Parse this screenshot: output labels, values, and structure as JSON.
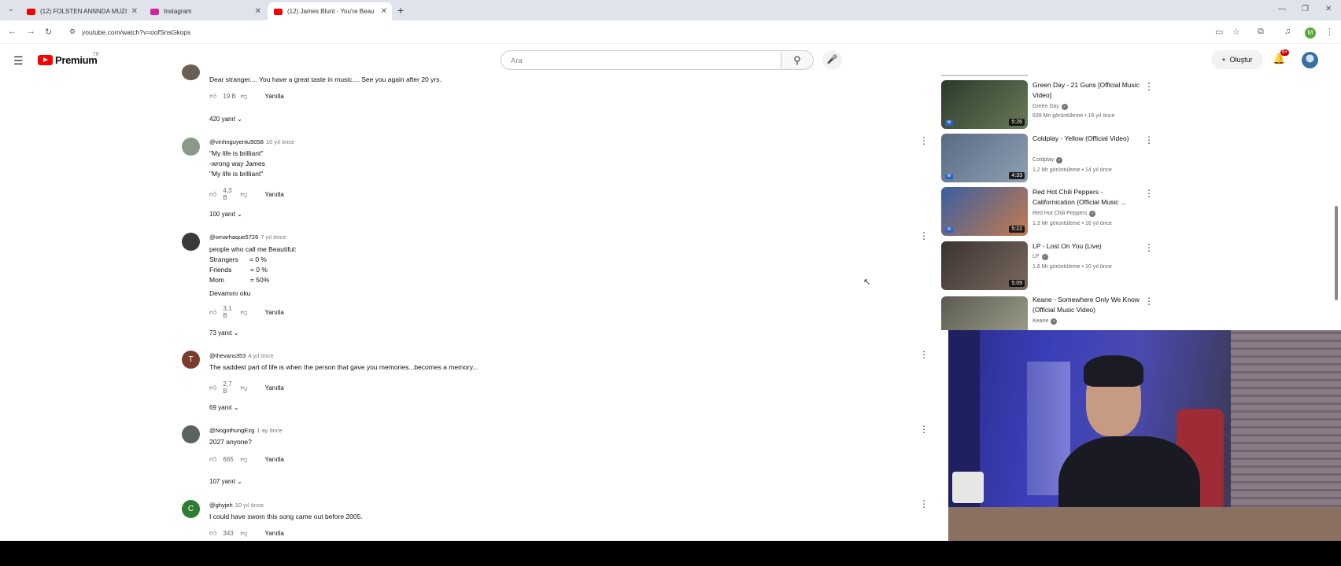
{
  "browser": {
    "tabs": [
      {
        "label": "(12) FOLSTEN ANNNDA MUZI...",
        "active": false,
        "color": "#ff0000"
      },
      {
        "label": "Instagram",
        "active": false,
        "color": "#d6249f"
      },
      {
        "label": "(12) James Blunt - You're Beau...",
        "active": true,
        "color": "#ff0000"
      }
    ],
    "url": "youtube.com/watch?v=oofSnsGkops",
    "profile_initial": "M"
  },
  "youtube": {
    "logo_text": "Premium",
    "logo_sup": "TR",
    "search_placeholder": "Ara",
    "create_label": "Oluştur",
    "notif_count": "9+"
  },
  "comments": [
    {
      "user": "",
      "time": "",
      "lines": [
        "Dear stranger.... You have a great taste in music.... See you again after 20 yrs."
      ],
      "likes": "19 B",
      "reply_label": "Yanıtla",
      "replies": "420 yanıt",
      "avatar_color": "#6b5f55",
      "avatar_letter": ""
    },
    {
      "user": "@vinhnguyentu5058",
      "time": "10 yıl önce",
      "lines": [
        "\"My life is brilliant\"",
        "-wrong way James",
        "\"My life is brilliant\""
      ],
      "likes": "4,3 B",
      "reply_label": "Yanıtla",
      "replies": "100 yanıt",
      "avatar_color": "#8a9a88",
      "avatar_letter": ""
    },
    {
      "user": "@omarhaque5726",
      "time": "7 yıl önce",
      "lines": [
        "people who call me Beautiful:",
        "Strangers      = 0 %",
        "Friends          = 0 %",
        "Mom              = 50%"
      ],
      "more": "Devamını oku",
      "likes": "3,1 B",
      "reply_label": "Yanıtla",
      "replies": "73 yanıt",
      "avatar_color": "#3a3a3a",
      "avatar_letter": ""
    },
    {
      "user": "@thevans353",
      "time": "4 yıl önce",
      "lines": [
        "The saddest part of life is when the person that gave you memories...becomes a memory..."
      ],
      "likes": "2,7 B",
      "reply_label": "Yanıtla",
      "replies": "69 yanıt",
      "avatar_color": "#7b3b2a",
      "avatar_letter": "T"
    },
    {
      "user": "@NogothungEzg",
      "time": "1 ay önce",
      "lines": [
        "2027 anyone?"
      ],
      "likes": "665",
      "reply_label": "Yanıtla",
      "replies": "107 yanıt",
      "avatar_color": "#5d6460",
      "avatar_letter": ""
    },
    {
      "user": "@ghyjeh",
      "time": "10 yıl önce",
      "lines": [
        "I could have sworn this song came out before 2005."
      ],
      "likes": "343",
      "reply_label": "Yanıtla",
      "replies": "",
      "avatar_color": "#2e7d32",
      "avatar_letter": "C"
    }
  ],
  "sidebar": [
    {
      "title": "Green Day - 21 Guns [Official Music Video]",
      "channel": "Green Day",
      "meta": "639 Mn görüntüleme • 16 yıl önce",
      "duration": "5:26",
      "thumb": [
        "#2a3a2a",
        "#6a7a5a"
      ]
    },
    {
      "title": "Coldplay - Yellow (Official Video)",
      "channel": "Coldplay",
      "meta": "1,2 Mr görüntüleme • 14 yıl önce",
      "duration": "4:33",
      "thumb": [
        "#5a6a82",
        "#8fa0b4"
      ]
    },
    {
      "title": "Red Hot Chili Peppers - Californication (Official Music ...",
      "channel": "Red Hot Chili Peppers",
      "meta": "1,3 Mr görüntüleme • 16 yıl önce",
      "duration": "5:22",
      "thumb": [
        "#3a5fa0",
        "#c47a50"
      ]
    },
    {
      "title": "LP - Lost On You (Live)",
      "channel": "LP",
      "meta": "1,6 Mr görüntüleme • 10 yıl önce",
      "duration": "5:09",
      "thumb": [
        "#3a3230",
        "#7a6a60"
      ]
    },
    {
      "title": "Keane - Somewhere Only We Know (Official Music Video)",
      "channel": "Keane",
      "meta": "",
      "duration": "",
      "thumb": [
        "#5a5a50",
        "#9a9a88"
      ]
    }
  ]
}
